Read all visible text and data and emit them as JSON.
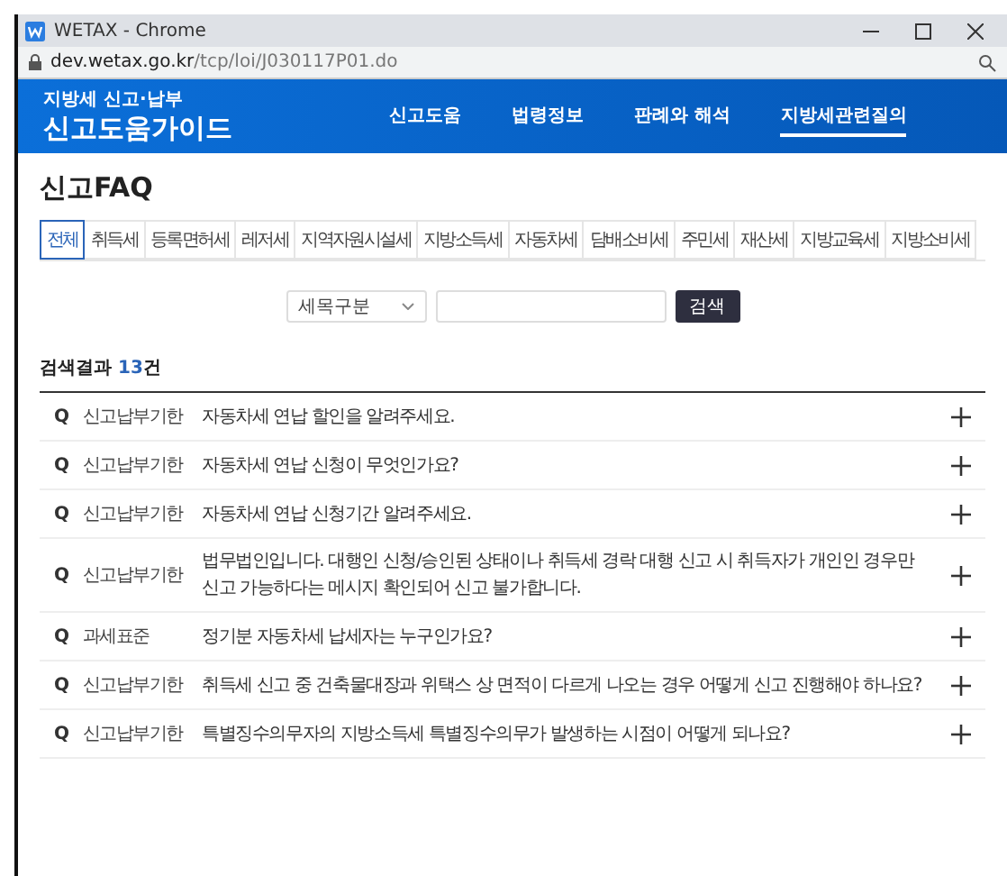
{
  "window": {
    "title": "WETAX - Chrome",
    "url_host": "dev.wetax.go.kr",
    "url_path": "/tcp/loi/J030117P01.do"
  },
  "header": {
    "subtitle": "지방세 신고·납부",
    "title": "신고도움가이드",
    "nav": [
      {
        "label": "신고도움",
        "selected": false
      },
      {
        "label": "법령정보",
        "selected": false
      },
      {
        "label": "판례와 해석",
        "selected": false
      },
      {
        "label": "지방세관련질의",
        "selected": true
      }
    ]
  },
  "page_title": "신고FAQ",
  "tabs": [
    {
      "label": "전체",
      "selected": true
    },
    {
      "label": "취득세",
      "selected": false
    },
    {
      "label": "등록면허세",
      "selected": false
    },
    {
      "label": "레저세",
      "selected": false
    },
    {
      "label": "지역자원시설세",
      "selected": false
    },
    {
      "label": "지방소득세",
      "selected": false
    },
    {
      "label": "자동차세",
      "selected": false
    },
    {
      "label": "담배소비세",
      "selected": false
    },
    {
      "label": "주민세",
      "selected": false
    },
    {
      "label": "재산세",
      "selected": false
    },
    {
      "label": "지방교육세",
      "selected": false
    },
    {
      "label": "지방소비세",
      "selected": false
    }
  ],
  "search": {
    "select": "세목구분",
    "button": "검색"
  },
  "results": {
    "label": "검색결과",
    "count": "13",
    "unit": "건"
  },
  "faqs": [
    {
      "mark": "Q",
      "category": "신고납부기한",
      "question": "자동차세 연납 할인을 알려주세요.",
      "expanded": false
    },
    {
      "mark": "Q",
      "category": "신고납부기한",
      "question": "자동차세 연납 신청이 무엇인가요?",
      "expanded": false
    },
    {
      "mark": "Q",
      "category": "신고납부기한",
      "question": "자동차세 연납 신청기간 알려주세요.",
      "expanded": false
    },
    {
      "mark": "Q",
      "category": "신고납부기한",
      "question": "법무법인입니다. 대행인 신청/승인된 상태이나 취득세 경락 대행 신고 시 취득자가 개인인 경우만 신고 가능하다는 메시지 확인되어 신고 불가합니다.",
      "expanded": false
    },
    {
      "mark": "Q",
      "category": "과세표준",
      "question": "정기분 자동차세 납세자는 누구인가요?",
      "expanded": false
    },
    {
      "mark": "Q",
      "category": "신고납부기한",
      "question": "취득세 신고 중 건축물대장과 위택스 상 면적이 다르게 나오는 경우 어떻게 신고 진행해야 하나요?",
      "expanded": false
    },
    {
      "mark": "Q",
      "category": "신고납부기한",
      "question": "특별징수의무자의 지방소득세 특별징수의무가 발생하는 시점이 어떻게 되나요?",
      "expanded": false
    }
  ]
}
